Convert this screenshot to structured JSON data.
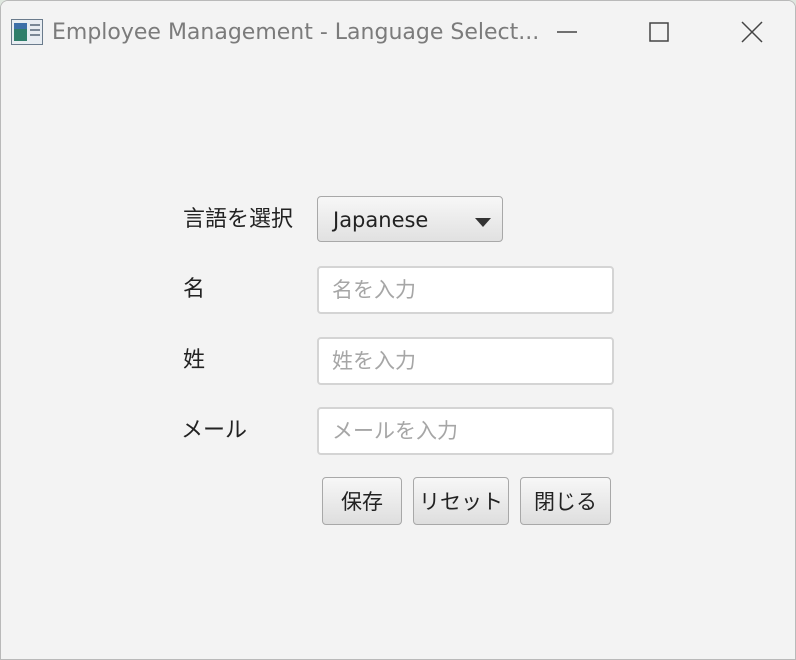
{
  "window": {
    "title": "Employee Management - Language Select..."
  },
  "form": {
    "language_label": "言語を選択",
    "language_selected": "Japanese",
    "first_name_label": "名",
    "first_name_placeholder": "名を入力",
    "first_name_value": "",
    "last_name_label": "姓",
    "last_name_placeholder": "姓を入力",
    "last_name_value": "",
    "email_label": "メール",
    "email_placeholder": "メールを入力",
    "email_value": ""
  },
  "buttons": {
    "save": "保存",
    "reset": "リセット",
    "close": "閉じる"
  },
  "icons": {
    "app": "app-window-icon",
    "minimize": "minimize-icon",
    "maximize": "maximize-icon",
    "close": "close-icon",
    "dropdown": "dropdown-arrow-icon"
  }
}
